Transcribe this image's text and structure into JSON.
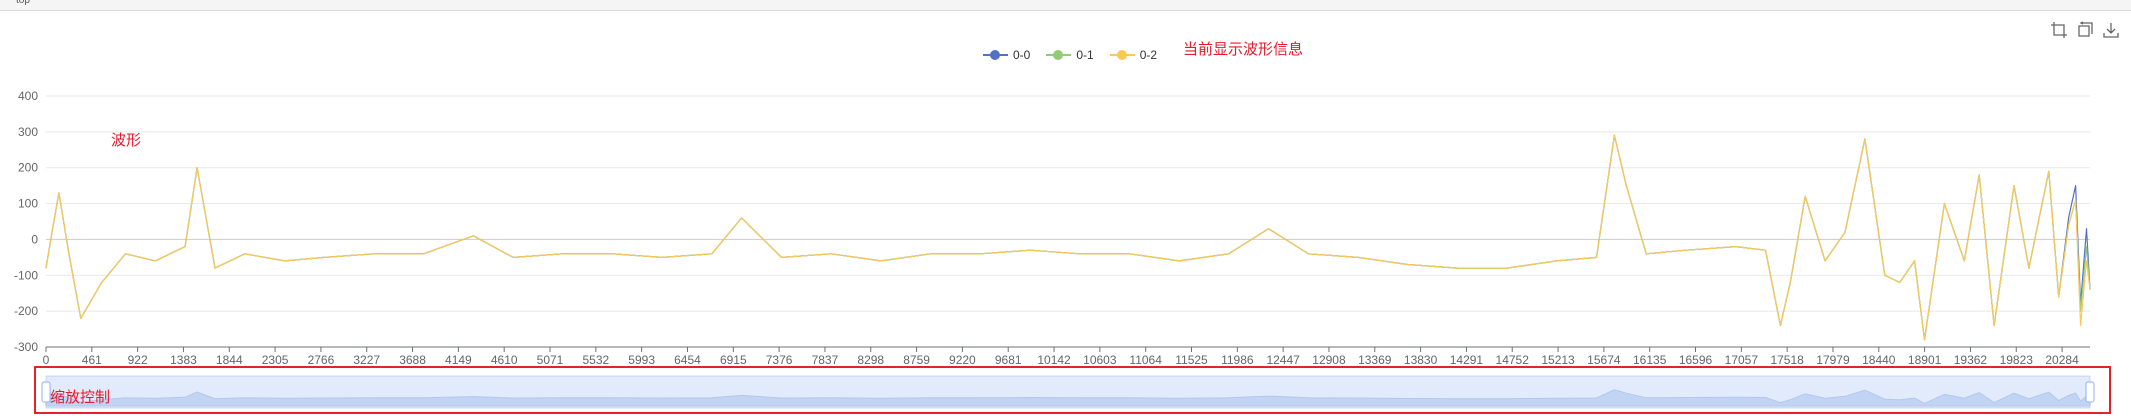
{
  "window": {
    "tab_label": "top"
  },
  "toolbox": {
    "icons": [
      "zoom-select-icon",
      "zoom-reset-icon",
      "save-image-icon"
    ]
  },
  "annotations": {
    "info_label": "当前显示波形信息",
    "waveform_label": "波形",
    "zoom_label": "缩放控制"
  },
  "colors": {
    "series_0": "#5470c6",
    "series_1": "#91cc75",
    "series_2": "#fac858",
    "annotation": "#e8192c"
  },
  "chart_data": {
    "type": "line",
    "legend": [
      "0-0",
      "0-1",
      "0-2"
    ],
    "legend_position": "top-center",
    "x": {
      "min": 0,
      "max": 20565,
      "ticks": [
        0,
        461,
        922,
        1383,
        1844,
        2305,
        2766,
        3227,
        3688,
        4149,
        4610,
        5071,
        5532,
        5993,
        6454,
        6915,
        7376,
        7837,
        8298,
        8759,
        9220,
        9681,
        10142,
        10603,
        11064,
        11525,
        11986,
        12447,
        12908,
        13369,
        13830,
        14291,
        14752,
        15213,
        15674,
        16135,
        16596,
        17057,
        17518,
        17979,
        18440,
        18901,
        19362,
        19823,
        20284
      ]
    },
    "y": {
      "min": -300,
      "max": 400,
      "ticks": [
        400,
        300,
        200,
        100,
        0,
        -100,
        -200,
        -300
      ]
    },
    "grid": true,
    "series": [
      {
        "name": "0-0",
        "x": [
          0,
          60,
          130,
          230,
          350,
          560,
          800,
          1100,
          1400,
          1520,
          1700,
          2000,
          2400,
          2800,
          3300,
          3800,
          4300,
          4700,
          5200,
          5700,
          6200,
          6700,
          7000,
          7400,
          7900,
          8400,
          8900,
          9400,
          9900,
          10400,
          10900,
          11400,
          11900,
          12300,
          12700,
          13200,
          13700,
          14200,
          14700,
          15200,
          15600,
          15780,
          15900,
          16100,
          16500,
          17000,
          17300,
          17450,
          17550,
          17700,
          17900,
          18100,
          18300,
          18500,
          18650,
          18800,
          18900,
          19100,
          19300,
          19450,
          19600,
          19800,
          19950,
          20150,
          20250,
          20350,
          20420,
          20470,
          20530,
          20565
        ],
        "y": [
          -80,
          20,
          130,
          -40,
          -220,
          -120,
          -40,
          -60,
          -20,
          200,
          -80,
          -40,
          -60,
          -50,
          -40,
          -40,
          10,
          -50,
          -40,
          -40,
          -50,
          -40,
          60,
          -50,
          -40,
          -60,
          -40,
          -40,
          -30,
          -40,
          -40,
          -60,
          -40,
          30,
          -40,
          -50,
          -70,
          -80,
          -80,
          -60,
          -50,
          290,
          150,
          -40,
          -30,
          -20,
          -30,
          -240,
          -120,
          120,
          -60,
          20,
          280,
          -100,
          -120,
          -60,
          -280,
          100,
          -60,
          180,
          -240,
          150,
          -80,
          190,
          -160,
          60,
          150,
          -180,
          30,
          -140
        ]
      },
      {
        "name": "0-1",
        "x": [
          0,
          60,
          130,
          230,
          350,
          560,
          800,
          1100,
          1400,
          1520,
          1700,
          2000,
          2400,
          2800,
          3300,
          3800,
          4300,
          4700,
          5200,
          5700,
          6200,
          6700,
          7000,
          7400,
          7900,
          8400,
          8900,
          9400,
          9900,
          10400,
          10900,
          11400,
          11900,
          12300,
          12700,
          13200,
          13700,
          14200,
          14700,
          15200,
          15600,
          15780,
          15900,
          16100,
          16500,
          17000,
          17300,
          17450,
          17550,
          17700,
          17900,
          18100,
          18300,
          18500,
          18650,
          18800,
          18900,
          19100,
          19300,
          19450,
          19600,
          19800,
          19950,
          20150,
          20250,
          20350,
          20420,
          20470,
          20530,
          20565
        ],
        "y": [
          -80,
          20,
          130,
          -40,
          -220,
          -120,
          -40,
          -60,
          -20,
          200,
          -80,
          -40,
          -60,
          -50,
          -40,
          -40,
          10,
          -50,
          -40,
          -40,
          -50,
          -40,
          60,
          -50,
          -40,
          -60,
          -40,
          -40,
          -30,
          -40,
          -40,
          -60,
          -40,
          30,
          -40,
          -50,
          -70,
          -80,
          -80,
          -60,
          -50,
          290,
          150,
          -40,
          -30,
          -20,
          -30,
          -240,
          -120,
          120,
          -60,
          20,
          280,
          -100,
          -120,
          -60,
          -280,
          100,
          -60,
          180,
          -240,
          150,
          -80,
          190,
          -160,
          40,
          110,
          -200,
          -20,
          -140
        ]
      },
      {
        "name": "0-2",
        "x": [
          0,
          60,
          130,
          230,
          350,
          560,
          800,
          1100,
          1400,
          1520,
          1700,
          2000,
          2400,
          2800,
          3300,
          3800,
          4300,
          4700,
          5200,
          5700,
          6200,
          6700,
          7000,
          7400,
          7900,
          8400,
          8900,
          9400,
          9900,
          10400,
          10900,
          11400,
          11900,
          12300,
          12700,
          13200,
          13700,
          14200,
          14700,
          15200,
          15600,
          15780,
          15900,
          16100,
          16500,
          17000,
          17300,
          17450,
          17550,
          17700,
          17900,
          18100,
          18300,
          18500,
          18650,
          18800,
          18900,
          19100,
          19300,
          19450,
          19600,
          19800,
          19950,
          20150,
          20250,
          20350,
          20420,
          20470,
          20530,
          20565
        ],
        "y": [
          -80,
          20,
          130,
          -40,
          -220,
          -120,
          -40,
          -60,
          -20,
          200,
          -80,
          -40,
          -60,
          -50,
          -40,
          -40,
          10,
          -50,
          -40,
          -40,
          -50,
          -40,
          60,
          -50,
          -40,
          -60,
          -40,
          -40,
          -30,
          -40,
          -40,
          -60,
          -40,
          30,
          -40,
          -50,
          -70,
          -80,
          -80,
          -60,
          -50,
          290,
          150,
          -40,
          -30,
          -20,
          -30,
          -240,
          -120,
          120,
          -60,
          20,
          280,
          -100,
          -120,
          -60,
          -280,
          100,
          -60,
          180,
          -240,
          150,
          -80,
          190,
          -160,
          40,
          110,
          -240,
          -60,
          -140
        ]
      }
    ],
    "datazoom": {
      "start_percent": 0,
      "end_percent": 100
    }
  }
}
